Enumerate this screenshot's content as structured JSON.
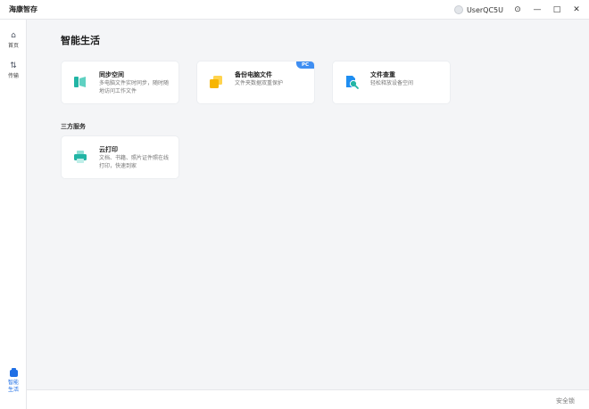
{
  "window": {
    "app_title": "海康智存",
    "username": "UserQC5U",
    "controls": {
      "settings_icon": "⊙",
      "minimize_icon": "—",
      "maximize_icon": "□",
      "close_icon": "✕"
    }
  },
  "sidebar": {
    "items": [
      {
        "label": "首页",
        "icon": "⌂"
      },
      {
        "label": "传输",
        "icon": "⇅"
      },
      {
        "label": "智能生活",
        "label_line1": "智能",
        "label_line2": "生活",
        "active": true
      }
    ]
  },
  "main": {
    "title": "智能生活",
    "cards": [
      {
        "title": "同步空间",
        "desc": "多电脑文件实时同步，随时随地访问工作文件"
      },
      {
        "title": "备份电脑文件",
        "desc": "文件夹数据双重保护",
        "badge": "PC"
      },
      {
        "title": "文件查重",
        "desc": "轻松释放设备空间"
      }
    ],
    "third_party_title": "三方服务",
    "third_party_cards": [
      {
        "title": "云打印",
        "desc": "文档、书籍、照片证件照在线打印，快速到家"
      }
    ]
  },
  "footer": {
    "safe_lock_label": "安全锁"
  },
  "colors": {
    "accent": "#1f6fe5",
    "teal": "#22b5a5",
    "yellow": "#f7b500",
    "badge_blue": "#3f8ef2"
  }
}
